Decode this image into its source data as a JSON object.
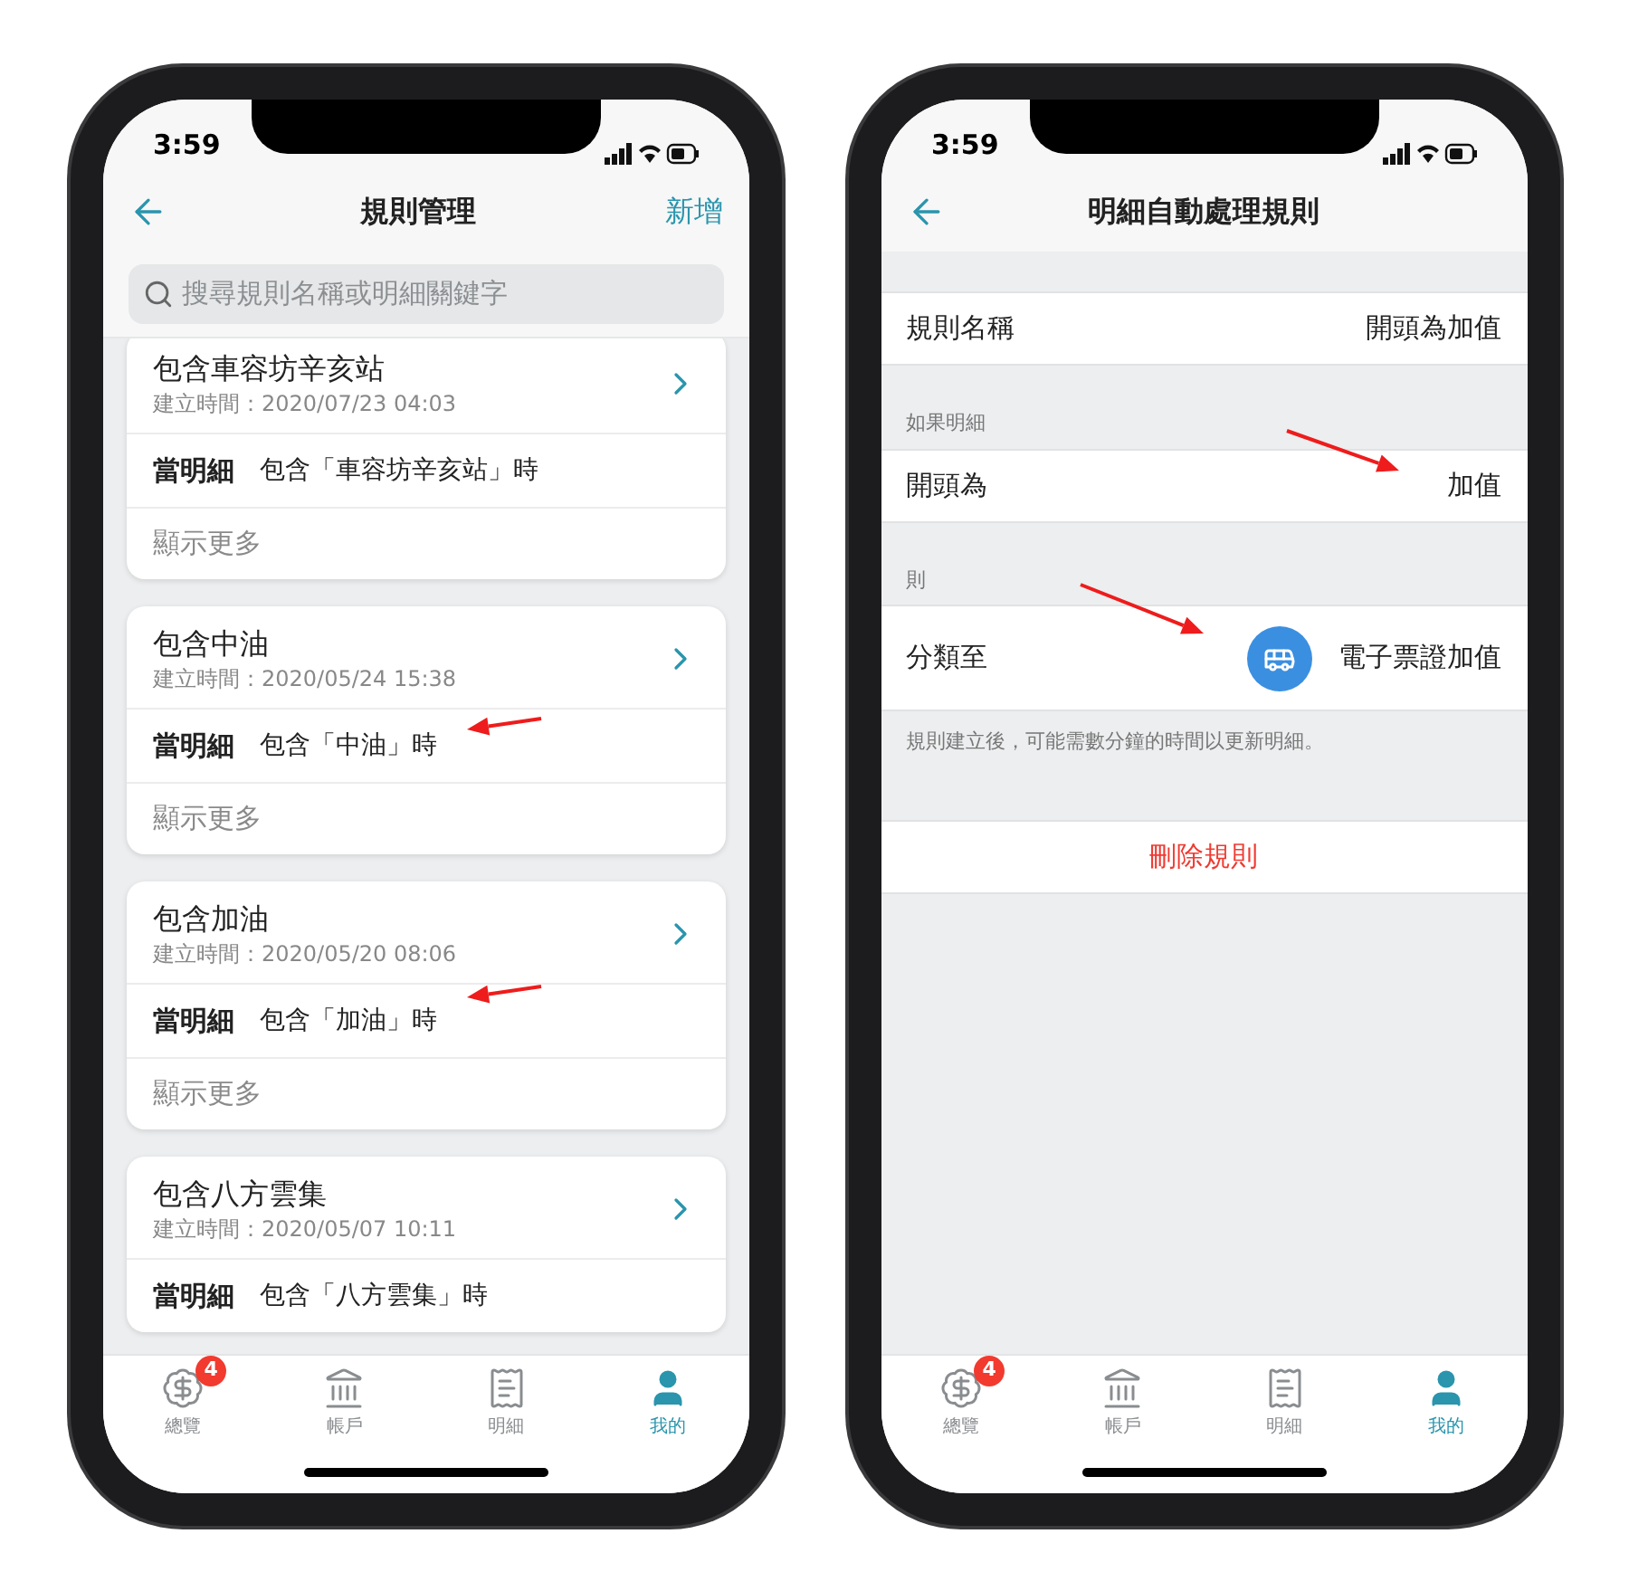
{
  "screens": [
    {
      "kind": "rule_list",
      "status_time": "3:59",
      "title": "規則管理",
      "action": "新增",
      "search": {
        "placeholder": "搜尋規則名稱或明細關鍵字"
      },
      "cards": [
        {
          "title": "包含車容坊辛亥站",
          "created": "建立時間：2020/07/23 04:03",
          "condition_label": "當明細",
          "condition": "包含「車容坊辛亥站」時",
          "more": "顯示更多"
        },
        {
          "title": "包含中油",
          "created": "建立時間：2020/05/24 15:38",
          "condition_label": "當明細",
          "condition": "包含「中油」時",
          "more": "顯示更多"
        },
        {
          "title": "包含加油",
          "created": "建立時間：2020/05/20 08:06",
          "condition_label": "當明細",
          "condition": "包含「加油」時",
          "more": "顯示更多"
        },
        {
          "title": "包含八方雲集",
          "created": "建立時間：2020/05/07 10:11",
          "condition_label": "當明細",
          "condition": "包含「八方雲集」時"
        }
      ],
      "tabs": [
        {
          "kind": "overview",
          "label": "總覽",
          "badge": "4",
          "selected": false
        },
        {
          "kind": "accounts",
          "label": "帳戶",
          "selected": false
        },
        {
          "kind": "details",
          "label": "明細",
          "selected": false
        },
        {
          "kind": "me",
          "label": "我的",
          "selected": true
        }
      ]
    },
    {
      "kind": "rule_detail",
      "status_time": "3:59",
      "title": "明細自動處理規則",
      "name_row": {
        "label": "規則名稱",
        "value": "開頭為加值"
      },
      "condition_section": "如果明細",
      "condition_row": {
        "label": "開頭為",
        "value": "加值"
      },
      "action_section": "則",
      "action_row": {
        "label": "分類至",
        "value": "電子票證加值"
      },
      "note": "規則建立後，可能需數分鐘的時間以更新明細。",
      "delete_button": "刪除規則",
      "tabs": [
        {
          "kind": "overview",
          "label": "總覽",
          "badge": "4",
          "selected": false
        },
        {
          "kind": "accounts",
          "label": "帳戶",
          "selected": false
        },
        {
          "kind": "details",
          "label": "明細",
          "selected": false
        },
        {
          "kind": "me",
          "label": "我的",
          "selected": true
        }
      ]
    }
  ]
}
